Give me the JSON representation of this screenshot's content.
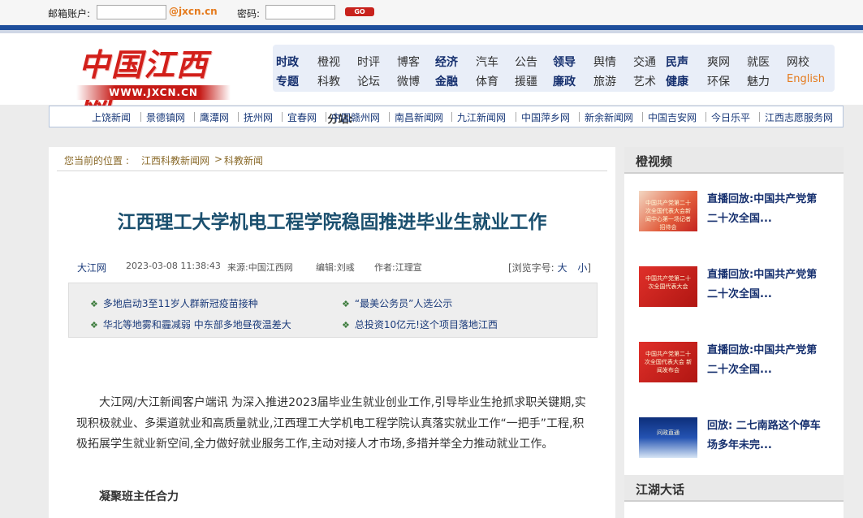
{
  "login": {
    "account_label": "邮箱账户:",
    "domain": "@jxcn.cn",
    "password_label": "密码:",
    "go_label": "GO"
  },
  "logo": {
    "name": "中国江西网",
    "url": "WWW.JXCN.CN"
  },
  "nav": {
    "row1": [
      "时政",
      "橙视",
      "时评",
      "博客",
      "经济",
      "汽车",
      "公告",
      "领导",
      "舆情",
      "交通",
      "民声",
      "爽网",
      "就医",
      "网校"
    ],
    "row2": [
      "专题",
      "科教",
      "论坛",
      "微博",
      "金融",
      "体育",
      "援疆",
      "廉政",
      "旅游",
      "艺术",
      "健康",
      "环保",
      "魅力",
      "English"
    ]
  },
  "subsites": {
    "title": "分站:",
    "items": [
      "上饶新闻",
      "景德镇网",
      "鹰潭网",
      "抚州网",
      "宜春网",
      "中国赣州网",
      "南昌新闻网",
      "九江新闻网",
      "中国萍乡网",
      "新余新闻网",
      "中国吉安网",
      "今日乐平",
      "江西志愿服务网"
    ]
  },
  "breadcrumb": {
    "prefix": "您当前的位置 :",
    "level1": "江西科教新闻网",
    "separator": ">",
    "level2": "科教新闻"
  },
  "article": {
    "title": "江西理工大学机电工程学院稳固推进毕业生就业工作",
    "source_link": "大江网",
    "date": "2023-03-08 11:38:43",
    "origin": "来源:中国江西网",
    "editor": "编辑:刘彧",
    "author": "作者:江理宣",
    "font_size_label": "[浏览字号:",
    "font_large": "大",
    "font_small": "小",
    "font_close": "]",
    "body": "大江网/大江新闻客户端讯 为深入推进2023届毕业生就业创业工作,引导毕业生抢抓求职关键期,实现积极就业、多渠道就业和高质量就业,江西理工大学机电工程学院认真落实就业工作“一把手”工程,积极拓展学生就业新空间,全力做好就业服务工作,主动对接人才市场,多措并举全力推动就业工作。",
    "subhead": "凝聚班主任合力"
  },
  "related": [
    "多地启动3至11岁人群新冠疫苗接种",
    "“最美公务员”人选公示",
    "华北等地雾和霾减弱 中东部多地昼夜温差大",
    "总投资10亿元!这个项目落地江西"
  ],
  "sidebar": {
    "video_heading": "橙视频",
    "videos": [
      {
        "line1": "直播回放:中国共产党第",
        "line2": "二十次全国...",
        "thumb_text": "中国共产党第二十次全国代表大会新闻中心第一场记者招待会"
      },
      {
        "line1": "直播回放:中国共产党第",
        "line2": "二十次全国...",
        "thumb_text": "中国共产党第二十次全国代表大会"
      },
      {
        "line1": "直播回放:中国共产党第",
        "line2": "二十次全国...",
        "thumb_text": "中国共产党第二十次全国代表大会 新闻发布会"
      },
      {
        "line1": "回放: 二七南路这个停车",
        "line2": "场多年未完...",
        "thumb_text": "问政直通"
      }
    ],
    "talk_heading": "江湖大话"
  }
}
